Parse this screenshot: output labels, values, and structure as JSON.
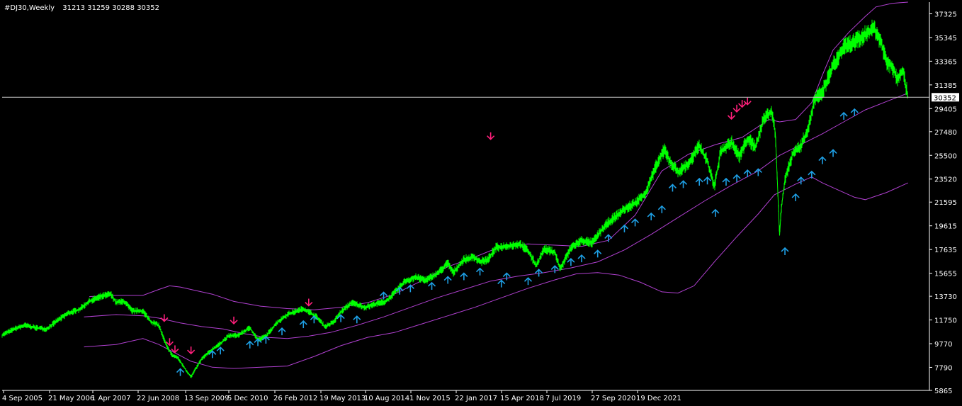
{
  "header": {
    "symbol": "#DJ30,Weekly",
    "ohlc": "31213 31259 30288 30352"
  },
  "current_price_label": "30352",
  "colors": {
    "background": "#000000",
    "price": "#00ff00",
    "bands": "#b040d0",
    "buy_arrow": "#1ea0e6",
    "sell_arrow": "#ff1f7a",
    "axis": "#ffffff",
    "price_line": "#c8c8c8",
    "label_box_bg": "#ffffff",
    "label_box_text": "#000000"
  },
  "chart_data": {
    "type": "line",
    "title": "#DJ30,Weekly",
    "x_tick_labels": [
      "4 Sep 2005",
      "21 May 2006",
      "1 Apr 2007",
      "22 Jun 2008",
      "13 Sep 2009",
      "5 Dec 2010",
      "26 Feb 2012",
      "19 May 2013",
      "10 Aug 2014",
      "1 Nov 2015",
      "22 Jan 2017",
      "15 Apr 2018",
      "7 Jul 2019",
      "27 Sep 2020",
      "19 Dec 2021"
    ],
    "y_tick_labels": [
      "37325",
      "35345",
      "33365",
      "31385",
      "29405",
      "27480",
      "25500",
      "23520",
      "21595",
      "19615",
      "17635",
      "15655",
      "13730",
      "11750",
      "9770",
      "7790",
      "5865"
    ],
    "y_ticks": [
      37325,
      35345,
      33365,
      31385,
      29405,
      27480,
      25500,
      23520,
      21595,
      19615,
      17635,
      15655,
      13730,
      11750,
      9770,
      7790,
      5865
    ],
    "ylim": [
      5865,
      38300
    ],
    "last_value": 30352,
    "grid": false,
    "series": [
      {
        "name": "",
        "kind": "price",
        "x": [
          2005.67,
          2005.9,
          2006.1,
          2006.3,
          2006.5,
          2006.7,
          2006.9,
          2007.1,
          2007.3,
          2007.5,
          2007.7,
          2007.8,
          2007.95,
          2008.1,
          2008.3,
          2008.45,
          2008.6,
          2008.75,
          2008.85,
          2008.95,
          2009.1,
          2009.2,
          2009.4,
          2009.6,
          2009.75,
          2009.9,
          2010.1,
          2010.3,
          2010.45,
          2010.6,
          2010.8,
          2011.0,
          2011.3,
          2011.55,
          2011.7,
          2011.85,
          2012.0,
          2012.2,
          2012.45,
          2012.65,
          2012.85,
          2013.0,
          2013.2,
          2013.4,
          2013.6,
          2013.8,
          2014.0,
          2014.1,
          2014.3,
          2014.5,
          2014.6,
          2014.75,
          2014.9,
          2015.1,
          2015.35,
          2015.5,
          2015.65,
          2015.8,
          2016.0,
          2016.1,
          2016.3,
          2016.5,
          2016.7,
          2016.85,
          2017.0,
          2017.3,
          2017.5,
          2017.7,
          2017.9,
          2018.05,
          2018.15,
          2018.3,
          2018.5,
          2018.7,
          2018.85,
          2018.98,
          2019.1,
          2019.3,
          2019.45,
          2019.6,
          2019.75,
          2019.9,
          2020.05,
          2020.12,
          2020.18,
          2020.2,
          2020.23,
          2020.3,
          2020.45,
          2020.6,
          2020.75,
          2020.85,
          2021.0,
          2021.2,
          2021.4,
          2021.55,
          2021.7,
          2021.85,
          2021.97,
          2022.1,
          2022.2,
          2022.3,
          2022.4,
          2022.5,
          2022.6
        ],
        "values": [
          10500,
          11000,
          11300,
          11100,
          11000,
          11700,
          12300,
          12600,
          13300,
          13700,
          13900,
          13200,
          13300,
          12500,
          12500,
          11600,
          11300,
          9500,
          8800,
          8600,
          7600,
          7000,
          8500,
          9300,
          9800,
          10400,
          10500,
          11100,
          10100,
          10400,
          11500,
          12200,
          12700,
          12000,
          11200,
          11500,
          12400,
          13200,
          12800,
          13100,
          13300,
          14000,
          15000,
          15300,
          15100,
          15600,
          16500,
          15700,
          16800,
          17000,
          16600,
          16800,
          17800,
          17900,
          18100,
          17500,
          16300,
          17700,
          17400,
          16000,
          17800,
          18400,
          18200,
          19100,
          19900,
          21000,
          21500,
          22400,
          24700,
          26000,
          25000,
          24100,
          24800,
          26300,
          25000,
          22900,
          25800,
          26600,
          25400,
          26900,
          26200,
          28500,
          29200,
          27400,
          21000,
          18800,
          21000,
          23500,
          25700,
          26300,
          28000,
          30100,
          30800,
          33000,
          34500,
          34900,
          35200,
          35800,
          36100,
          34900,
          33300,
          33000,
          31900,
          32700,
          30352
        ]
      },
      {
        "name": "",
        "kind": "upper_band",
        "x": [
          2007.3,
          2007.8,
          2008.3,
          2008.6,
          2008.8,
          2009.0,
          2009.3,
          2009.6,
          2010.0,
          2010.5,
          2011.0,
          2011.5,
          2012.0,
          2012.5,
          2013.0,
          2013.5,
          2014.0,
          2014.5,
          2015.0,
          2015.5,
          2016.0,
          2016.5,
          2017.0,
          2017.5,
          2018.0,
          2018.5,
          2019.0,
          2019.5,
          2020.0,
          2020.2,
          2020.5,
          2020.8,
          2021.0,
          2021.2,
          2021.5,
          2021.8,
          2022.0,
          2022.3,
          2022.6
        ],
        "values": [
          13700,
          13800,
          13800,
          14300,
          14600,
          14500,
          14200,
          13900,
          13300,
          12900,
          12700,
          12600,
          12800,
          13200,
          13900,
          15000,
          16200,
          17000,
          17900,
          18100,
          18000,
          17900,
          18400,
          20500,
          24200,
          25600,
          26400,
          27000,
          28500,
          28300,
          28500,
          29900,
          32200,
          34300,
          35800,
          37100,
          37900,
          38200,
          38300
        ]
      },
      {
        "name": "",
        "kind": "middle_band",
        "x": [
          2007.2,
          2007.8,
          2008.3,
          2008.6,
          2009.0,
          2009.4,
          2009.8,
          2010.2,
          2010.6,
          2011.0,
          2011.4,
          2011.8,
          2012.3,
          2012.8,
          2013.3,
          2013.8,
          2014.3,
          2014.8,
          2015.3,
          2015.8,
          2016.3,
          2016.8,
          2017.3,
          2017.8,
          2018.3,
          2018.8,
          2019.3,
          2019.8,
          2020.2,
          2020.6,
          2021.0,
          2021.4,
          2021.8,
          2022.2,
          2022.6
        ],
        "values": [
          12000,
          12200,
          12100,
          11900,
          11500,
          11200,
          11000,
          10600,
          10300,
          10200,
          10400,
          10700,
          11300,
          12000,
          12800,
          13600,
          14300,
          15000,
          15400,
          15700,
          16100,
          16600,
          17600,
          18900,
          20300,
          21700,
          23000,
          24200,
          25500,
          26400,
          27300,
          28300,
          29300,
          30000,
          30700
        ]
      },
      {
        "name": "",
        "kind": "lower_band",
        "x": [
          2007.2,
          2007.8,
          2008.3,
          2008.6,
          2008.9,
          2009.2,
          2009.6,
          2010.0,
          2010.5,
          2011.0,
          2011.5,
          2012.0,
          2012.5,
          2013.0,
          2013.5,
          2014.0,
          2014.5,
          2015.0,
          2015.5,
          2016.0,
          2016.4,
          2016.8,
          2017.2,
          2017.6,
          2018.0,
          2018.3,
          2018.6,
          2019.0,
          2019.4,
          2019.8,
          2020.1,
          2020.5,
          2020.8,
          2021.0,
          2021.3,
          2021.6,
          2021.8,
          2022.2,
          2022.6
        ],
        "values": [
          9500,
          9700,
          10200,
          9700,
          9000,
          8300,
          7800,
          7700,
          7800,
          7900,
          8700,
          9600,
          10300,
          10700,
          11400,
          12100,
          12800,
          13600,
          14400,
          15100,
          15600,
          15700,
          15500,
          14900,
          14100,
          14000,
          14600,
          16700,
          18700,
          20600,
          22200,
          23100,
          23700,
          23200,
          22600,
          22000,
          21800,
          22400,
          23200
        ]
      },
      {
        "name": "",
        "kind": "buy_signals",
        "x": [
          2009.0,
          2009.6,
          2009.75,
          2010.3,
          2010.45,
          2010.6,
          2010.9,
          2011.3,
          2011.5,
          2012.0,
          2012.3,
          2012.8,
          2013.1,
          2013.3,
          2013.7,
          2014.0,
          2014.3,
          2014.6,
          2015.0,
          2015.1,
          2015.5,
          2015.7,
          2016.0,
          2016.3,
          2016.5,
          2016.8,
          2017.0,
          2017.3,
          2017.5,
          2017.8,
          2018.0,
          2018.2,
          2018.4,
          2018.7,
          2018.85,
          2019.0,
          2019.2,
          2019.4,
          2019.6,
          2019.8,
          2020.3,
          2020.5,
          2020.6,
          2020.8,
          2021.0,
          2021.2,
          2021.4,
          2021.6
        ],
        "values": [
          7900,
          9400,
          9700,
          10200,
          10400,
          10600,
          11300,
          11900,
          12300,
          12400,
          12300,
          14300,
          14700,
          14900,
          15100,
          15600,
          15900,
          16300,
          15300,
          15900,
          15500,
          16200,
          16500,
          17100,
          17400,
          17800,
          19100,
          19900,
          20400,
          20900,
          21500,
          23300,
          23600,
          23800,
          23900,
          21200,
          23800,
          24100,
          24500,
          24600,
          18000,
          22500,
          23900,
          24400,
          25600,
          26200,
          29300,
          29600
        ]
      },
      {
        "name": "",
        "kind": "sell_signals",
        "x": [
          2008.7,
          2008.8,
          2008.9,
          2009.2,
          2010.0,
          2011.4,
          2014.8,
          2019.3,
          2019.4,
          2019.5,
          2019.6
        ],
        "values": [
          11400,
          9400,
          8800,
          8700,
          11200,
          12700,
          26600,
          28300,
          28900,
          29300,
          29500
        ]
      }
    ]
  }
}
